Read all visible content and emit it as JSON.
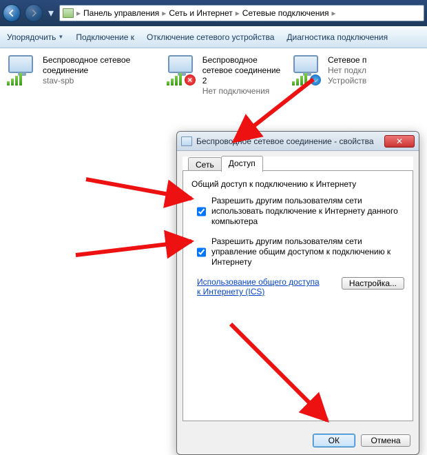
{
  "nav": {
    "crumbs": [
      "Панель управления",
      "Сеть и Интернет",
      "Сетевые подключения"
    ]
  },
  "toolbar": {
    "organize": "Упорядочить",
    "connect": "Подключение к",
    "disable": "Отключение сетевого устройства",
    "diagnose": "Диагностика подключения"
  },
  "connections": [
    {
      "title": "Беспроводное сетевое соединение",
      "sub": "stav-spb",
      "overlay": "none"
    },
    {
      "title": "Беспроводное сетевое соединение 2",
      "sub": "Нет подключения",
      "overlay": "x"
    },
    {
      "title": "Сетевое п",
      "sub": "Нет подкл",
      "sub2": "Устройств",
      "overlay": "bt"
    }
  ],
  "dialog": {
    "title": "Беспроводное сетевое соединение - свойства",
    "tabs": {
      "network": "Сеть",
      "sharing": "Доступ"
    },
    "section": "Общий доступ к подключению к Интернету",
    "check1": "Разрешить другим пользователям сети использовать подключение к Интернету данного компьютера",
    "check2": "Разрешить другим пользователям сети управление общим доступом к подключению к Интернету",
    "link": "Использование общего доступа к Интернету (ICS)",
    "settings_btn": "Настройка...",
    "ok": "ОК",
    "cancel": "Отмена"
  }
}
